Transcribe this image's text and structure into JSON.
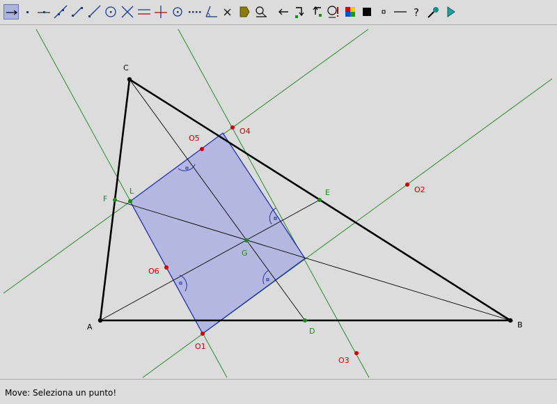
{
  "status": {
    "message": "Move: Seleziona un punto!"
  },
  "colors": {
    "background": "#dcdcdc",
    "toolbar_active": "#aab4dc",
    "triangle": "#000000",
    "line_green": "#2a8a2a",
    "point_red": "#cc0000",
    "point_green": "#1a8a1a",
    "rectangle_fill": "#b4b8e0",
    "rectangle_stroke": "#2030b0"
  },
  "toolbar": {
    "tools": [
      {
        "name": "move-tool-icon",
        "active": true
      },
      {
        "name": "point-tool-icon"
      },
      {
        "name": "point-on-line-tool-icon"
      },
      {
        "name": "line-tool-icon"
      },
      {
        "name": "segment-tool-icon"
      },
      {
        "name": "ray-tool-icon"
      },
      {
        "name": "circle-tool-icon"
      },
      {
        "name": "intersection-tool-icon"
      },
      {
        "name": "parallel-tool-icon"
      },
      {
        "name": "perpendicular-tool-icon"
      },
      {
        "name": "midpoint-tool-icon"
      },
      {
        "name": "locus-tool-icon"
      },
      {
        "name": "angle-tool-icon"
      },
      {
        "name": "delete-tool-icon"
      },
      {
        "name": "label-tool-icon"
      },
      {
        "name": "measure-tool-icon"
      },
      {
        "name": "undo-tool-icon"
      },
      {
        "name": "redo-tool-icon"
      },
      {
        "name": "back-tool-icon"
      },
      {
        "name": "info-tool-icon"
      },
      {
        "name": "color-tool-icon"
      },
      {
        "name": "fill-tool-icon"
      },
      {
        "name": "point-style-tool-icon"
      },
      {
        "name": "line-style-tool-icon"
      },
      {
        "name": "help-tool-icon"
      },
      {
        "name": "zoom-tool-icon"
      },
      {
        "name": "play-tool-icon"
      }
    ]
  },
  "figure": {
    "points": [
      {
        "label": "A",
        "color": "black"
      },
      {
        "label": "B",
        "color": "black"
      },
      {
        "label": "C",
        "color": "black"
      },
      {
        "label": "D",
        "color": "green"
      },
      {
        "label": "E",
        "color": "green"
      },
      {
        "label": "F",
        "color": "green"
      },
      {
        "label": "G",
        "color": "green"
      },
      {
        "label": "L",
        "color": "green"
      },
      {
        "label": "O1",
        "color": "red"
      },
      {
        "label": "O2",
        "color": "red"
      },
      {
        "label": "O3",
        "color": "red"
      },
      {
        "label": "O4",
        "color": "red"
      },
      {
        "label": "O5",
        "color": "red"
      },
      {
        "label": "O6",
        "color": "red"
      }
    ]
  }
}
